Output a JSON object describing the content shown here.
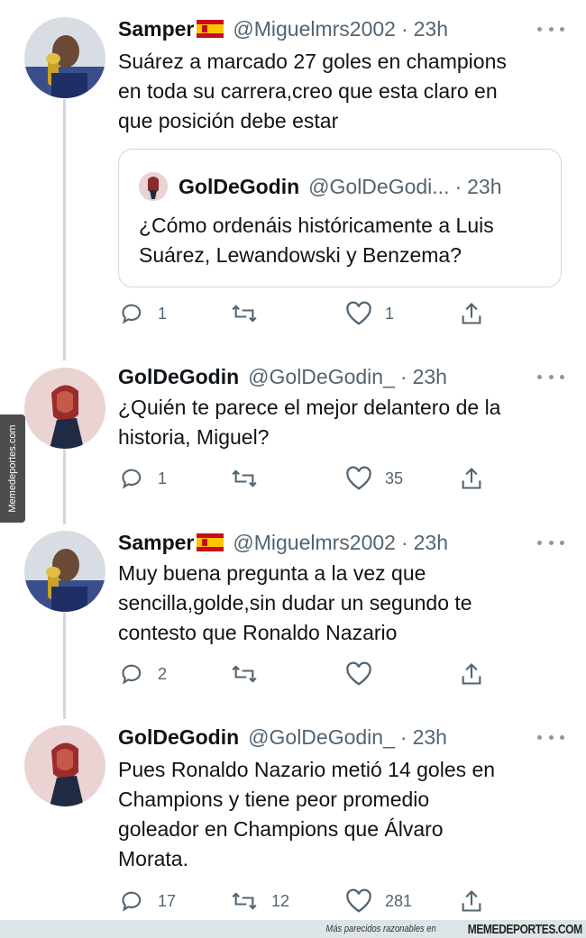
{
  "tweets": [
    {
      "name": "Samper",
      "flag": "spain-flag",
      "handle": "@Miguelmrs2002",
      "time": "23h",
      "lines": [
        "Suárez a marcado 27 goles en champions",
        "en toda su carrera,creo que esta claro en",
        "que posición debe estar"
      ],
      "quote": {
        "name": "GolDeGodin",
        "handle": "@GolDeGodi...",
        "time": "23h",
        "lines": [
          "¿Cómo ordenáis históricamente a Luis",
          "Suárez, Lewandowski y Benzema?"
        ]
      },
      "replies": "1",
      "retweets": "",
      "likes": "1"
    },
    {
      "name": "GolDeGodin",
      "handle": "@GolDeGodin_",
      "time": "23h",
      "lines": [
        "¿Quién te parece el mejor delantero de la",
        "historia, Miguel?"
      ],
      "replies": "1",
      "retweets": "",
      "likes": "35"
    },
    {
      "name": "Samper",
      "flag": "spain-flag",
      "handle": "@Miguelmrs2002",
      "time": "23h",
      "lines": [
        "Muy buena pregunta a la vez que",
        "sencilla,golde,sin dudar un segundo te",
        "contesto que Ronaldo Nazario"
      ],
      "replies": "2",
      "retweets": "",
      "likes": ""
    },
    {
      "name": "GolDeGodin",
      "handle": "@GolDeGodin_",
      "time": "23h",
      "lines": [
        "Pues Ronaldo Nazario metió 14 goles en",
        "Champions y tiene peor promedio",
        "goleador en Champions que Álvaro",
        "Morata."
      ],
      "replies": "17",
      "retweets": "12",
      "likes": "281"
    }
  ],
  "separator": "·",
  "watermark": {
    "side": "Memedeportes.com",
    "footer_small": "Más parecidos razonables en",
    "footer_brand": "MEMEDEPORTES.COM"
  },
  "colors": {
    "text": "#0f1419",
    "secondary": "#536471",
    "border": "#cfd9de"
  }
}
